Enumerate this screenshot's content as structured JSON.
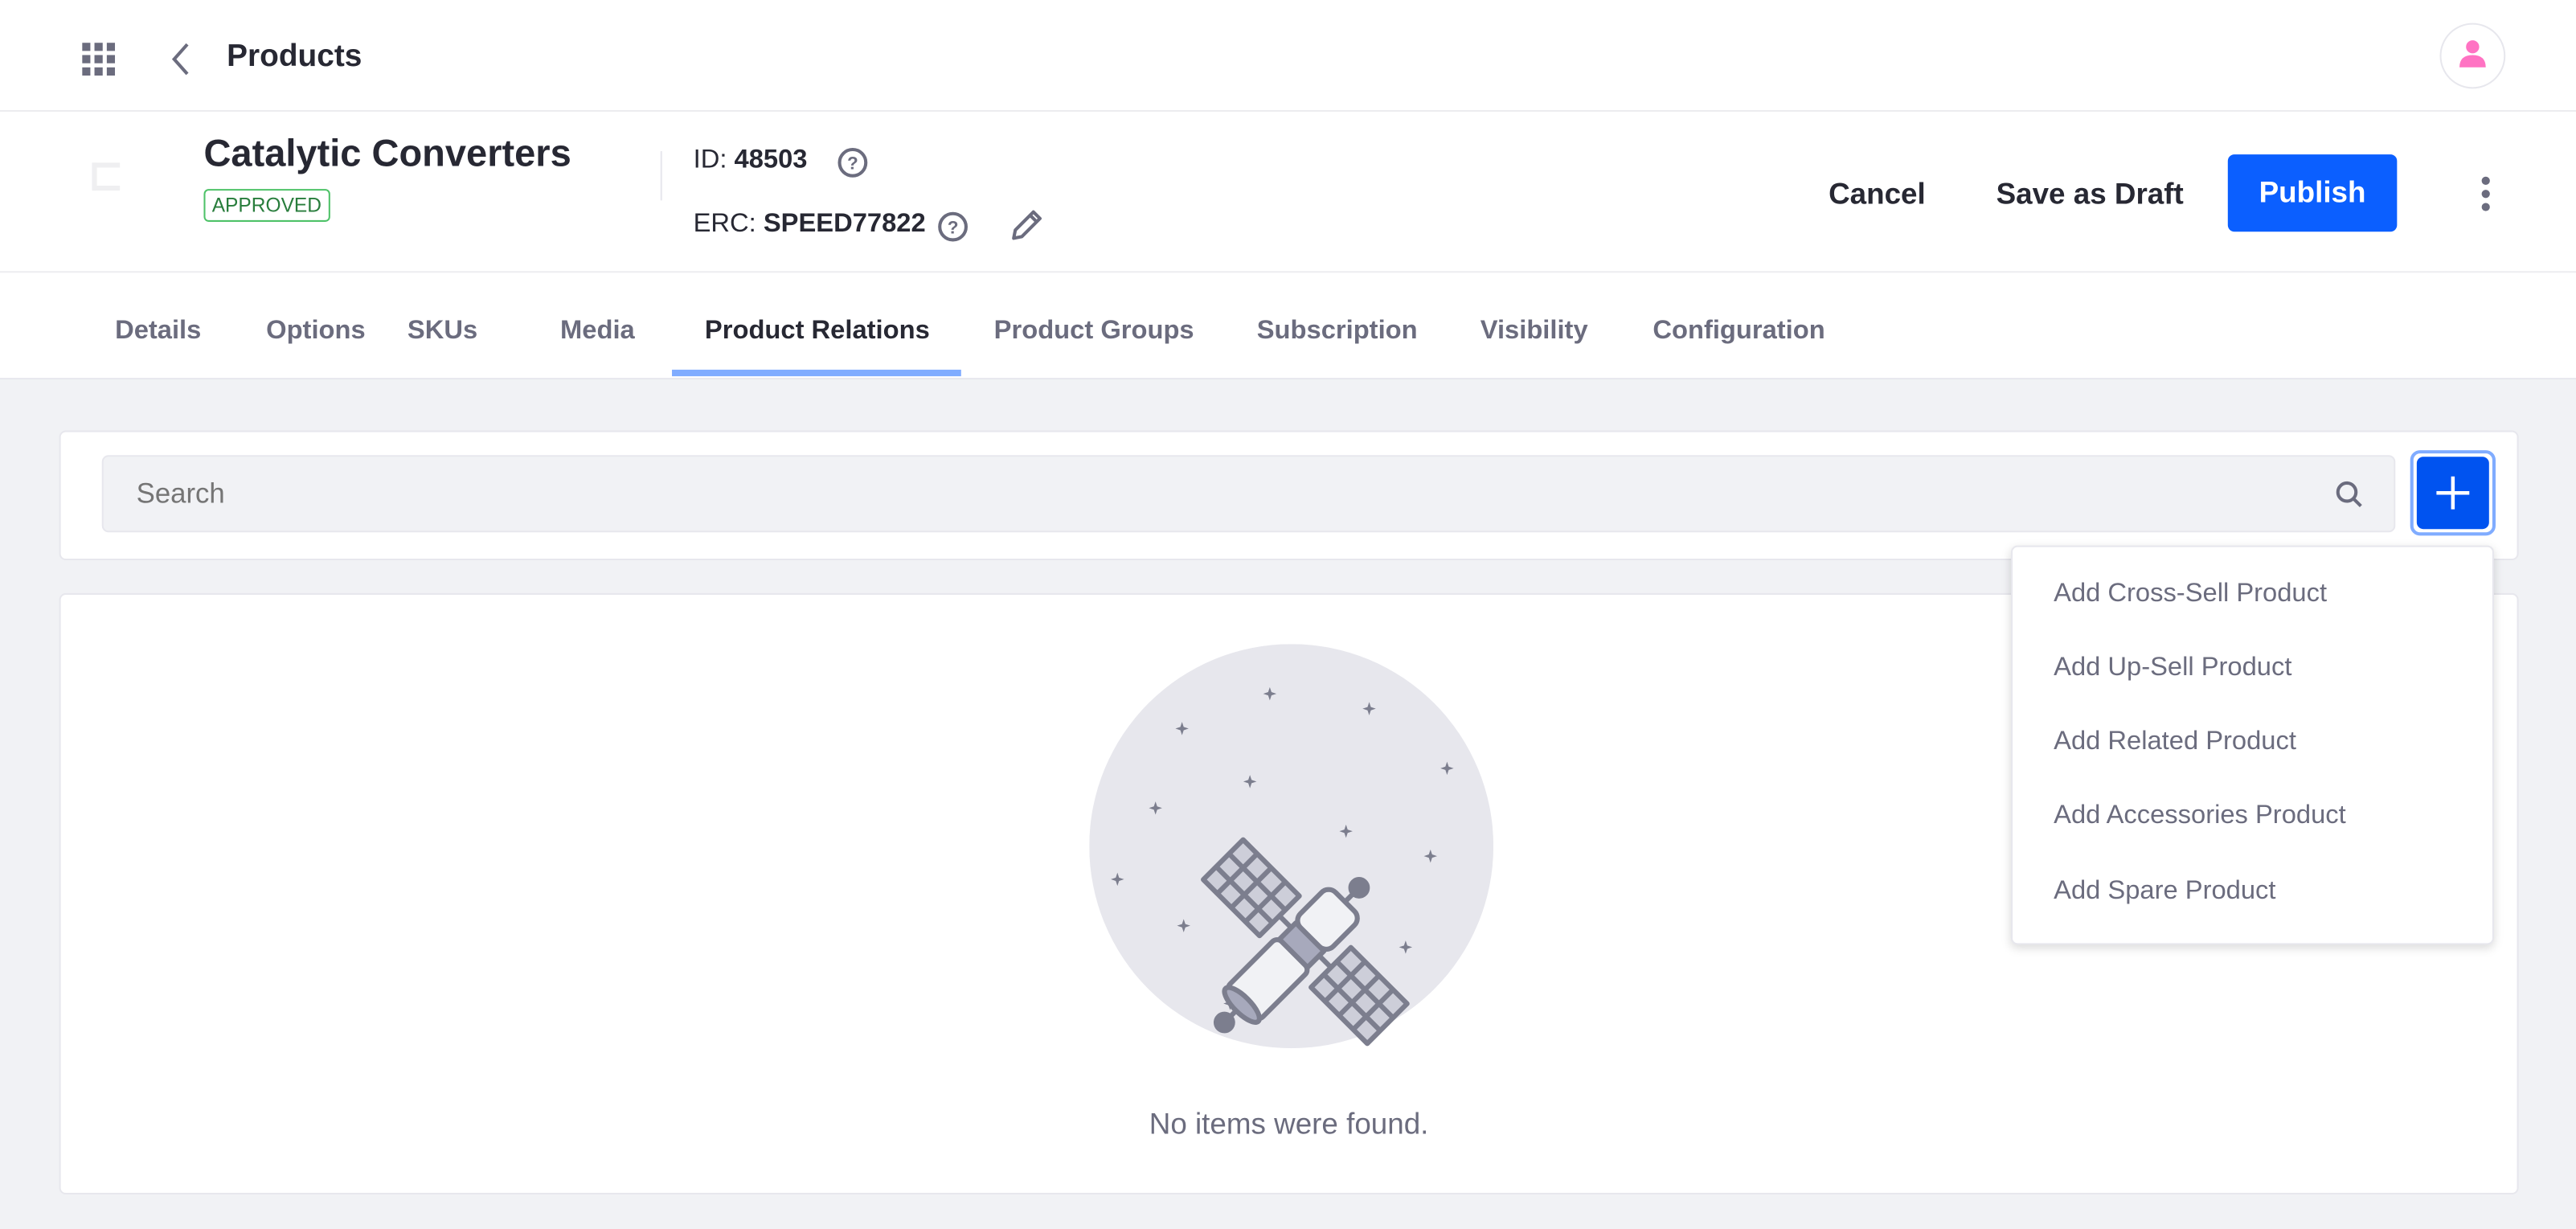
{
  "topbar": {
    "title": "Products",
    "apps_icon": "grid-icon",
    "back_icon": "chevron-left-icon",
    "avatar_icon": "user-icon",
    "avatar_color": "#ff73c3"
  },
  "product": {
    "name": "Catalytic Converters",
    "status": "APPROVED",
    "id_label": "ID:",
    "id_value": "48503",
    "erc_label": "ERC:",
    "erc_value": "SPEED77822"
  },
  "actions": {
    "cancel": "Cancel",
    "save_draft": "Save as Draft",
    "publish": "Publish",
    "publish_color": "#0b5fff"
  },
  "tabs": [
    {
      "label": "Details"
    },
    {
      "label": "Options"
    },
    {
      "label": "SKUs"
    },
    {
      "label": "Media"
    },
    {
      "label": "Product Relations",
      "active": true
    },
    {
      "label": "Product Groups"
    },
    {
      "label": "Subscription"
    },
    {
      "label": "Visibility"
    },
    {
      "label": "Configuration"
    }
  ],
  "search": {
    "placeholder": "Search"
  },
  "add_menu": {
    "items": [
      {
        "label": "Add Cross-Sell Product"
      },
      {
        "label": "Add Up-Sell Product"
      },
      {
        "label": "Add Related Product"
      },
      {
        "label": "Add Accessories Product"
      },
      {
        "label": "Add Spare Product"
      }
    ]
  },
  "empty_state": {
    "message": "No items were found.",
    "illustration": "satellite-icon"
  }
}
